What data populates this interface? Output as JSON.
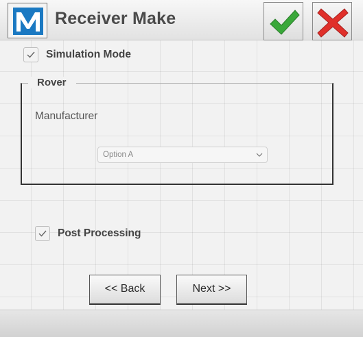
{
  "header": {
    "logo_icon": "m-logo-icon",
    "title": "Receiver Make",
    "ok_icon": "green-checkmark-icon",
    "cancel_icon": "red-x-icon",
    "ok_color": "#3aa83a",
    "cancel_color": "#e0302a"
  },
  "simulation": {
    "label": "Simulation Mode",
    "checked": true
  },
  "rover": {
    "legend": "Rover",
    "manufacturer_label": "Manufacturer",
    "manufacturer_value": "Option A"
  },
  "post_processing": {
    "label": "Post Processing",
    "checked": true
  },
  "navigation": {
    "back_label": "<< Back",
    "next_label": "Next >>"
  }
}
